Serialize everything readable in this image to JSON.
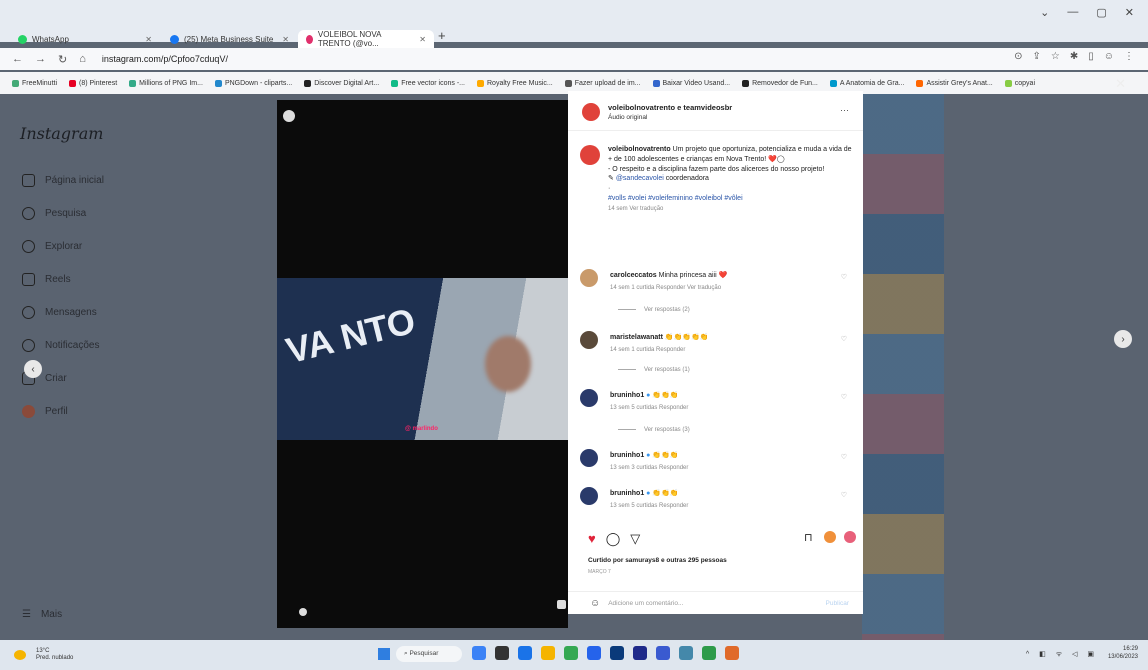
{
  "browser": {
    "tabs": [
      {
        "label": "WhatsApp",
        "color": "#25d366"
      },
      {
        "label": "(25) Meta Business Suite",
        "color": "#1877f2"
      },
      {
        "label": "VOLEIBOL NOVA TRENTO (@vo...",
        "color": "#e1306c"
      }
    ],
    "new_tab": "+",
    "url": "instagram.com/p/Cpfoo7cduqV/",
    "bookmarks": [
      {
        "label": "FreeMinutti",
        "color": "#4a7"
      },
      {
        "label": "(8) Pinterest",
        "color": "#e60023"
      },
      {
        "label": "Millions of PNG Im...",
        "color": "#3a8"
      },
      {
        "label": "PNGDown - cliparts...",
        "color": "#28c"
      },
      {
        "label": "Discover Digital Art...",
        "color": "#222"
      },
      {
        "label": "Free vector icons -...",
        "color": "#1b8"
      },
      {
        "label": "Royalty Free Music...",
        "color": "#fa0"
      },
      {
        "label": "Fazer upload de im...",
        "color": "#555"
      },
      {
        "label": "Baixar Video Usand...",
        "color": "#36c"
      },
      {
        "label": "Removedor de Fun...",
        "color": "#222"
      },
      {
        "label": "A Anatomia de Gra...",
        "color": "#09c"
      },
      {
        "label": "Assistir Grey's Anat...",
        "color": "#f60"
      },
      {
        "label": "copyai",
        "color": "#8c4"
      }
    ]
  },
  "instagram": {
    "logo": "Instagram",
    "nav": [
      {
        "label": "Página inicial",
        "icon": "home-icon"
      },
      {
        "label": "Pesquisa",
        "icon": "search-icon"
      },
      {
        "label": "Explorar",
        "icon": "compass-icon"
      },
      {
        "label": "Reels",
        "icon": "reels-icon"
      },
      {
        "label": "Mensagens",
        "icon": "message-icon"
      },
      {
        "label": "Notificações",
        "icon": "heart-icon"
      },
      {
        "label": "Criar",
        "icon": "plus-icon"
      },
      {
        "label": "Perfil",
        "icon": "avatar-icon"
      }
    ],
    "more": "Mais"
  },
  "video": {
    "overlay_text": "VA NTO",
    "subtitle": "@ marlindo"
  },
  "post": {
    "author": "voleibolnovatrento e teamvideosbr",
    "audio": "Áudio original",
    "caption_user": "voleibolnovatrento",
    "caption_text": "Um projeto que oportuniza, potencializa e muda a vida de + de 100 adolescentes e crianças em Nova Trento! ❤️◯",
    "caption_line2": "- O respeito e a disciplina fazem parte dos alicerces do nosso projeto!",
    "caption_mention": "@sandecavolei",
    "caption_mention_suffix": "coordenadora",
    "hashtags": "#volls #volei #voleifeminino #voleibol #vôlei",
    "caption_meta": "14 sem   Ver tradução",
    "comments": [
      {
        "user": "carolceccatos",
        "text": "Minha princesa aiii ❤️",
        "meta": "14 sem   1 curtida   Responder   Ver tradução",
        "replies": "Ver respostas (2)"
      },
      {
        "user": "maristelawanatt",
        "text": "👏👏👏👏👏",
        "meta": "14 sem   1 curtida   Responder",
        "replies": "Ver respostas (1)"
      },
      {
        "user": "bruninho1",
        "text": "👏👏👏",
        "meta": "13 sem   5 curtidas   Responder",
        "replies": "Ver respostas (3)"
      },
      {
        "user": "bruninho1",
        "text": "👏👏👏",
        "meta": "13 sem   3 curtidas   Responder",
        "replies": ""
      },
      {
        "user": "bruninho1",
        "text": "👏👏👏",
        "meta": "13 sem   5 curtidas   Responder",
        "replies": ""
      }
    ],
    "liked_by": "Curtido por samurays8 e outras 295 pessoas",
    "date": "MARÇO 7",
    "add_comment_placeholder": "Adicione um comentário...",
    "publish": "Publicar"
  },
  "taskbar": {
    "temp": "13°C",
    "weather": "Pred. nublado",
    "search": "Pesquisar",
    "time": "16:29",
    "date": "13/06/2023"
  }
}
